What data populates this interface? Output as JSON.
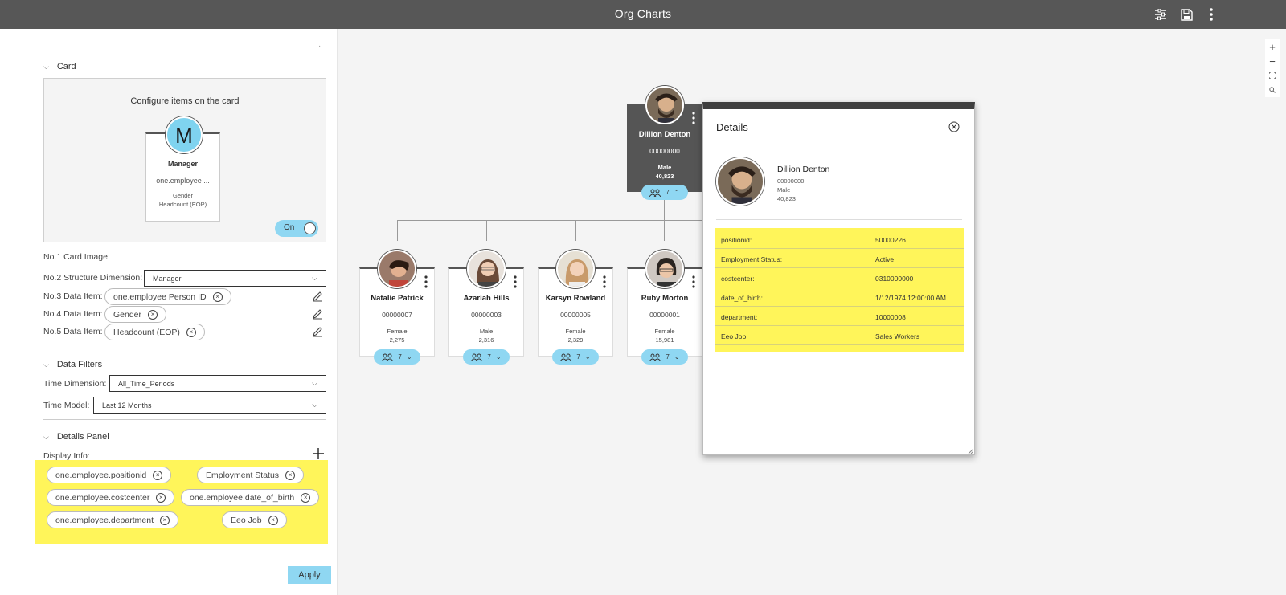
{
  "app": {
    "title": "Org Charts"
  },
  "left": {
    "dot": "·",
    "card_section": {
      "title": "Card",
      "configure_title": "Configure items on the card"
    },
    "mini_card": {
      "initial": "M",
      "name": "Manager",
      "id": "one.employee ...",
      "line1": "Gender",
      "line2": "Headcount (EOP)"
    },
    "rows": {
      "card_image_label": "No.1 Card Image:",
      "toggle_label": "On",
      "structure_label": "No.2 Structure Dimension:",
      "structure_value": "Manager",
      "data3_label": "No.3 Data Item:",
      "data3_value": "one.employee Person ID",
      "data4_label": "No.4 Data Item:",
      "data4_value": "Gender",
      "data5_label": "No.5 Data Item:",
      "data5_value": "Headcount (EOP)"
    },
    "filters": {
      "title": "Data Filters",
      "time_dim_label": "Time Dimension:",
      "time_dim_value": "All_Time_Periods",
      "time_model_label": "Time Model:",
      "time_model_value": "Last 12 Months"
    },
    "details_panel": {
      "title": "Details Panel",
      "display_label": "Display Info:",
      "chips": [
        "one.employee.positionid",
        "Employment Status",
        "one.employee.costcenter",
        "one.employee.date_of_birth",
        "one.employee.department",
        "Eeo Job"
      ]
    },
    "apply_label": "Apply"
  },
  "chart": {
    "root": {
      "name": "Dillion Denton",
      "id": "00000000",
      "gender": "Male",
      "count": "40,823",
      "reports": "7"
    },
    "children": [
      {
        "name": "Natalie Patrick",
        "id": "00000007",
        "gender": "Female",
        "count": "2,275",
        "reports": "7"
      },
      {
        "name": "Azariah Hills",
        "id": "00000003",
        "gender": "Male",
        "count": "2,316",
        "reports": "7"
      },
      {
        "name": "Karsyn Rowland",
        "id": "00000005",
        "gender": "Female",
        "count": "2,329",
        "reports": "7"
      },
      {
        "name": "Ruby Morton",
        "id": "00000001",
        "gender": "Female",
        "count": "15,981",
        "reports": "7"
      }
    ]
  },
  "details": {
    "title": "Details",
    "name": "Dillion Denton",
    "id": "00000000",
    "gender": "Male",
    "count": "40,823",
    "rows": [
      {
        "k": "positionid:",
        "v": "50000226"
      },
      {
        "k": "Employment Status:",
        "v": "Active"
      },
      {
        "k": "costcenter:",
        "v": "0310000000"
      },
      {
        "k": "date_of_birth:",
        "v": "1/12/1974 12:00:00 AM"
      },
      {
        "k": "department:",
        "v": "10000008"
      },
      {
        "k": "Eeo Job:",
        "v": "Sales Workers"
      }
    ]
  },
  "zoom": {
    "plus": "+",
    "minus": "−"
  },
  "colors": {
    "accent": "#8fd7f2",
    "highlight": "#fff55a",
    "topbar": "#575757",
    "root_card": "#555555"
  }
}
